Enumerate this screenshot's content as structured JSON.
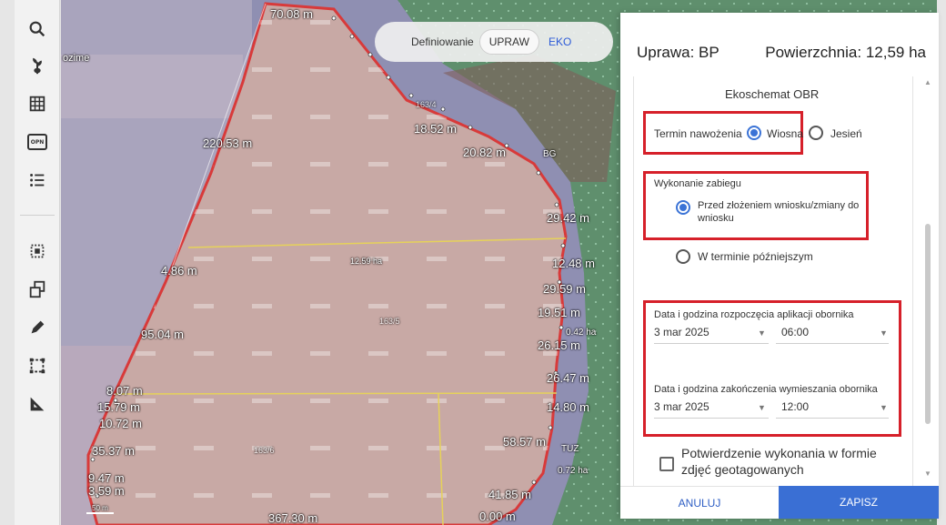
{
  "toolbar": {
    "tools": [
      {
        "name": "search",
        "icon": "search-icon"
      },
      {
        "name": "crop",
        "icon": "plant-icon"
      },
      {
        "name": "grid",
        "icon": "grid-icon"
      },
      {
        "name": "opn",
        "icon": "opn-icon",
        "text": "OPN"
      },
      {
        "name": "list",
        "icon": "list-icon"
      },
      {
        "name": "select-area",
        "icon": "select-area-icon"
      },
      {
        "name": "copy",
        "icon": "copy-icon"
      },
      {
        "name": "draw",
        "icon": "pencil-icon"
      },
      {
        "name": "measure-area",
        "icon": "frame-icon"
      },
      {
        "name": "measure",
        "icon": "ruler-icon"
      }
    ]
  },
  "modebar": {
    "label": "Definiowanie",
    "active": "UPRAW",
    "other": "EKO"
  },
  "map": {
    "distances": [
      "70.08 m",
      "220.53 m",
      "4.86 m",
      "95.04 m",
      "8.07 m",
      "15.79 m",
      "10.72 m",
      "35.37 m",
      "9.47 m",
      "3.59 m",
      "20.82 m",
      "18.52 m",
      "29.42 m",
      "12.48 m",
      "29.59 m",
      "19.51 m",
      "26.15 m",
      "26.47 m",
      "14.80 m",
      "58.57 m",
      "41.85 m",
      "0.00 m",
      "367.30 m"
    ],
    "area_label": "12.59 ha",
    "parcel_ids": [
      "163/4",
      "163/5",
      "163/6"
    ],
    "tags": [
      "BG",
      "TUZ",
      "0.42 ha",
      "0.72 ha",
      "ozime"
    ],
    "watermark": "GC0204",
    "scale": "50 m"
  },
  "panel": {
    "crop_label": "Uprawa: BP",
    "area_label": "Powierzchnia: 12,59 ha",
    "section_title": "Ekoschemat OBR",
    "fertilization": {
      "label": "Termin nawożenia",
      "option_spring": "Wiosna",
      "option_autumn": "Jesień",
      "selected": "Wiosna"
    },
    "execution": {
      "label": "Wykonanie zabiegu",
      "option_before_line1": "Przed złożeniem wniosku/zmiany do",
      "option_before_line2": "wniosku",
      "option_later": "W terminie późniejszym",
      "selected": "Przed złożeniem wniosku/zmiany do wniosku"
    },
    "start": {
      "label": "Data i godzina rozpoczęcia aplikacji obornika",
      "date": "3 mar 2025",
      "time": "06:00"
    },
    "end": {
      "label": "Data i godzina zakończenia wymieszania obornika",
      "date": "3 mar 2025",
      "time": "12:00"
    },
    "photo_confirm_line1": "Potwierdzenie wykonania w formie",
    "photo_confirm_line2": "zdjęć geotagowanych",
    "cancel_label": "ANULUJ",
    "save_label": "ZAPISZ"
  },
  "colors": {
    "accent": "#3a6fd4",
    "highlight": "#d6202a",
    "field": "#c9a9a3",
    "meadow": "#6a9a78"
  }
}
